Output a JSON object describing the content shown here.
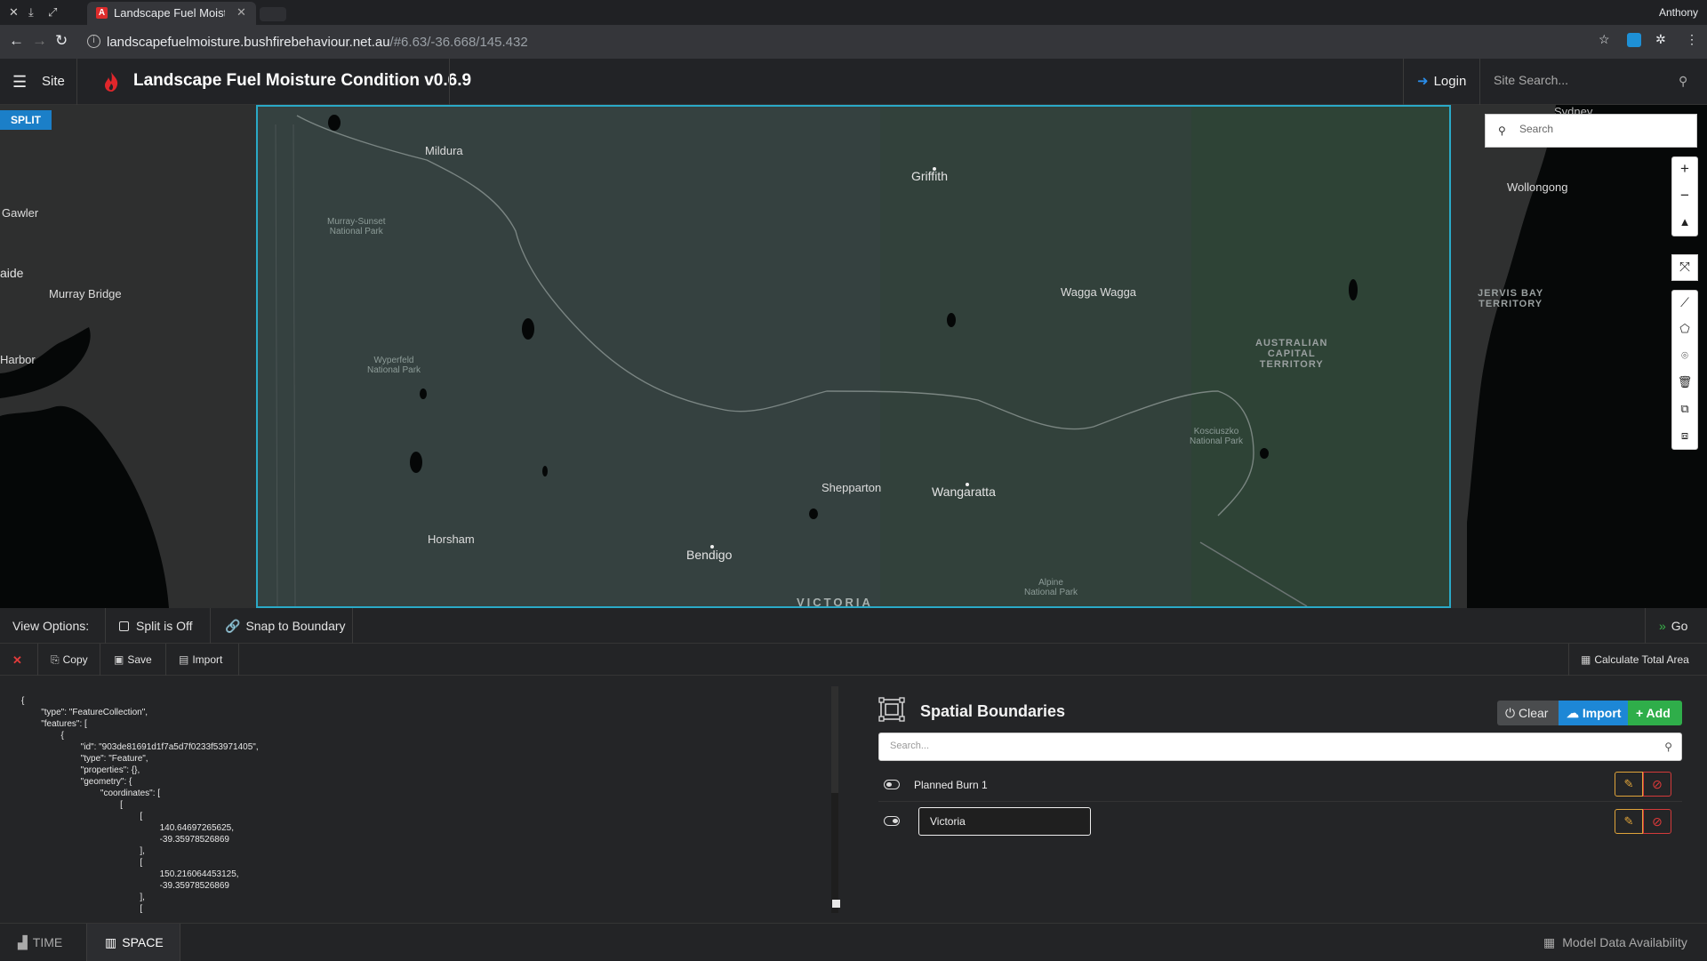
{
  "browser": {
    "tab_title": "Landscape Fuel Moisture",
    "url_host": "landscapefuelmoisture.bushfirebehaviour.net.au",
    "url_rest": "/#6.63/-36.668/145.432",
    "profile": "Anthony"
  },
  "header": {
    "menu_label": "Site",
    "title": "Landscape Fuel Moisture Condition v0.6.9",
    "login": "Login",
    "site_search_placeholder": "Site Search..."
  },
  "map": {
    "split_badge": "SPLIT",
    "search_placeholder": "Search",
    "places": {
      "mildura": "Mildura",
      "griffith": "Griffith",
      "gawler": "Gawler",
      "aide": "aide",
      "murray_bridge": "Murray Bridge",
      "harbor": "Harbor",
      "wagga": "Wagga Wagga",
      "shepparton": "Shepparton",
      "wangaratta": "Wangaratta",
      "horsham": "Horsham",
      "bendigo": "Bendigo",
      "victoria": "VICTORIA",
      "wollongong": "Wollongong",
      "sydney": "Sydney"
    },
    "parks": {
      "murray_sunset": "Murray-Sunset\nNational Park",
      "wyperfeld": "Wyperfeld\nNational Park",
      "kosciuszko": "Kosciuszko\nNational Park",
      "alpine": "Alpine\nNational Park"
    },
    "territories": {
      "act": "AUSTRALIAN\nCAPITAL\nTERRITORY",
      "jervis": "JERVIS BAY\nTERRITORY"
    }
  },
  "view_options": {
    "label": "View Options:",
    "split": "Split is Off",
    "snap": "Snap to Boundary",
    "go": "Go"
  },
  "toolbar": {
    "copy": "Copy",
    "save": "Save",
    "import": "Import",
    "calculate": "Calculate Total Area"
  },
  "geojson_text": "{\n        \"type\": \"FeatureCollection\",\n        \"features\": [\n                {\n                        \"id\": \"903de81691d1f7a5d7f0233f53971405\",\n                        \"type\": \"Feature\",\n                        \"properties\": {},\n                        \"geometry\": {\n                                \"coordinates\": [\n                                        [\n                                                [\n                                                        140.64697265625,\n                                                        -39.35978526869\n                                                ],\n                                                [\n                                                        150.216064453125,\n                                                        -39.35978526869\n                                                ],\n                                                [",
  "spatial_boundaries": {
    "title": "Spatial Boundaries",
    "clear": "Clear",
    "import": "Import",
    "add": "Add",
    "search_placeholder": "Search...",
    "rows": [
      {
        "label": "Planned Burn 1",
        "visible": false
      },
      {
        "label": "Victoria",
        "visible": true
      }
    ]
  },
  "bottom": {
    "time": "TIME",
    "space": "SPACE",
    "model_data": "Model Data Availability"
  },
  "colors": {
    "accent_blue": "#1d87d6",
    "add_green": "#2fae4a",
    "split_border": "#2aa9c7",
    "edit_orange": "#e0a43a",
    "delete_red": "#d43a3a"
  }
}
